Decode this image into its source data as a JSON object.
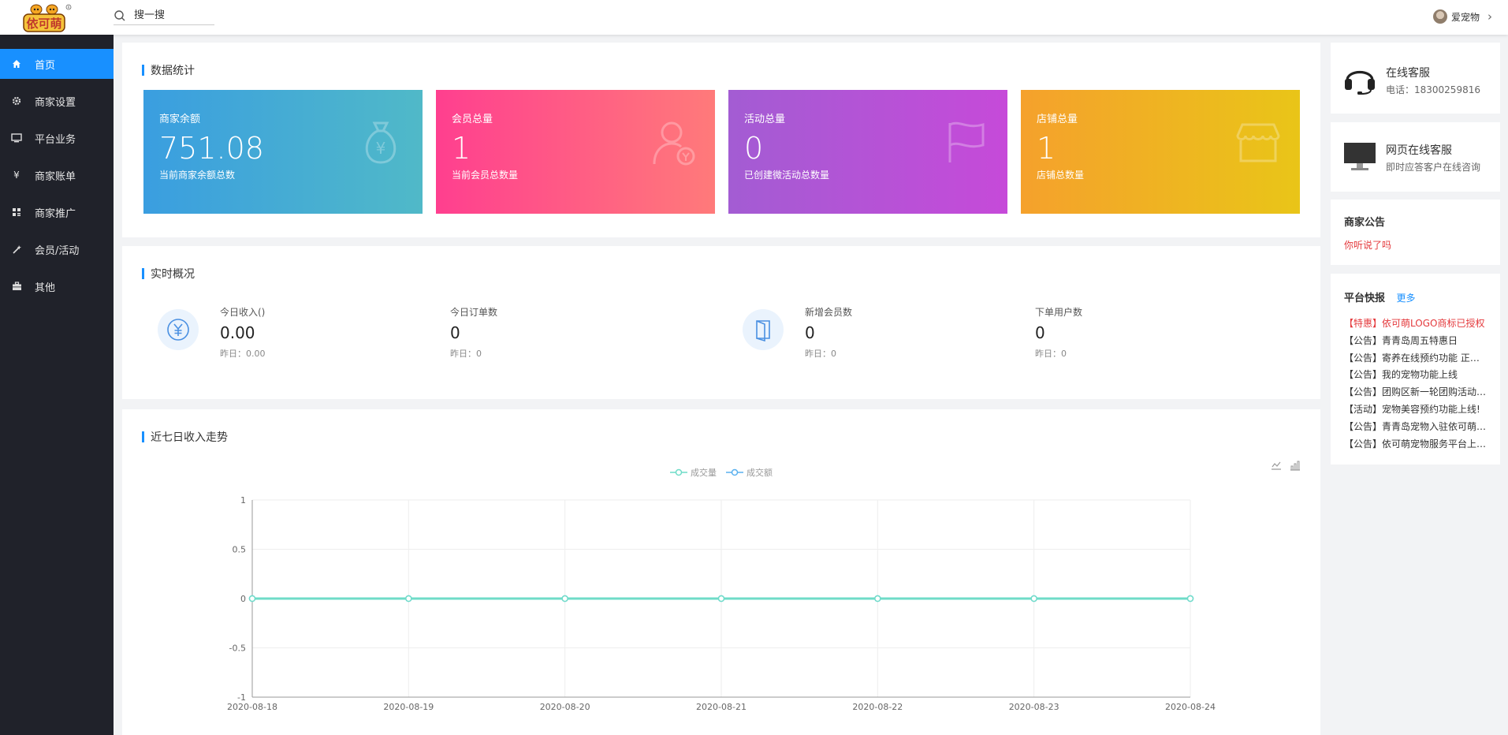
{
  "header": {
    "logo_text": "依可萌",
    "search_placeholder": "搜一搜",
    "user_name": "爱宠物"
  },
  "sidebar": {
    "items": [
      {
        "label": "首页",
        "icon": "home-icon",
        "active": true
      },
      {
        "label": "商家设置",
        "icon": "gear-icon"
      },
      {
        "label": "平台业务",
        "icon": "monitor-icon"
      },
      {
        "label": "商家账单",
        "icon": "yen-icon"
      },
      {
        "label": "商家推广",
        "icon": "grid-icon"
      },
      {
        "label": "会员/活动",
        "icon": "wand-icon"
      },
      {
        "label": "其他",
        "icon": "briefcase-icon"
      }
    ]
  },
  "stats": {
    "title": "数据统计",
    "cards": [
      {
        "label": "商家余额",
        "value": "751.08",
        "desc": "当前商家余额总数",
        "icon": "money-bag-icon"
      },
      {
        "label": "会员总量",
        "value": "1",
        "desc": "当前会员总数量",
        "icon": "member-icon"
      },
      {
        "label": "活动总量",
        "value": "0",
        "desc": "已创建微活动总数量",
        "icon": "flag-icon"
      },
      {
        "label": "店铺总量",
        "value": "1",
        "desc": "店铺总数量",
        "icon": "store-icon"
      }
    ],
    "colors": [
      "#3a9ee0",
      "#ff4d8d",
      "#b150d8",
      "#f5b225"
    ]
  },
  "realtime": {
    "title": "实时概况",
    "items": [
      {
        "label": "今日收入()",
        "value": "0.00",
        "sub": "昨日：0.00"
      },
      {
        "label": "今日订单数",
        "value": "0",
        "sub": "昨日：0"
      },
      {
        "label": "新增会员数",
        "value": "0",
        "sub": "昨日：0"
      },
      {
        "label": "下单用户数",
        "value": "0",
        "sub": "昨日：0"
      }
    ]
  },
  "trend": {
    "title": "近七日收入走势",
    "legend": [
      "成交量",
      "成交额"
    ]
  },
  "chart_data": {
    "type": "line",
    "title": "近七日收入走势",
    "x": [
      "2020-08-18",
      "2020-08-19",
      "2020-08-20",
      "2020-08-21",
      "2020-08-22",
      "2020-08-23",
      "2020-08-24"
    ],
    "series": [
      {
        "name": "成交量",
        "values": [
          0,
          0,
          0,
          0,
          0,
          0,
          0
        ],
        "color": "#6fdcc8"
      },
      {
        "name": "成交额",
        "values": [
          0,
          0,
          0,
          0,
          0,
          0,
          0
        ],
        "color": "#5ab1ef"
      }
    ],
    "ylim": [
      -1,
      1
    ],
    "yticks": [
      "1",
      "0.5",
      "0",
      "-0.5",
      "-1"
    ],
    "grid": true,
    "legend_position": "top-center"
  },
  "service": {
    "online_title": "在线客服",
    "online_phone": "电话：18300259816",
    "web_title": "网页在线客服",
    "web_sub": "即时应答客户在线咨询"
  },
  "notice": {
    "title": "商家公告",
    "text": "你听说了吗"
  },
  "news": {
    "title": "平台快报",
    "more": "更多",
    "items": [
      {
        "text": "【特惠】依可萌LOGO商标已授权",
        "hot": true
      },
      {
        "text": "【公告】青青岛周五特惠日"
      },
      {
        "text": "【公告】寄养在线预约功能 正式上线"
      },
      {
        "text": "【公告】我的宠物功能上线"
      },
      {
        "text": "【公告】团购区新一轮团购活动开始"
      },
      {
        "text": "【活动】宠物美容预约功能上线!"
      },
      {
        "text": "【公告】青青岛宠物入驻依可萌平台"
      },
      {
        "text": "【公告】依可萌宠物服务平台上线啦"
      }
    ]
  }
}
